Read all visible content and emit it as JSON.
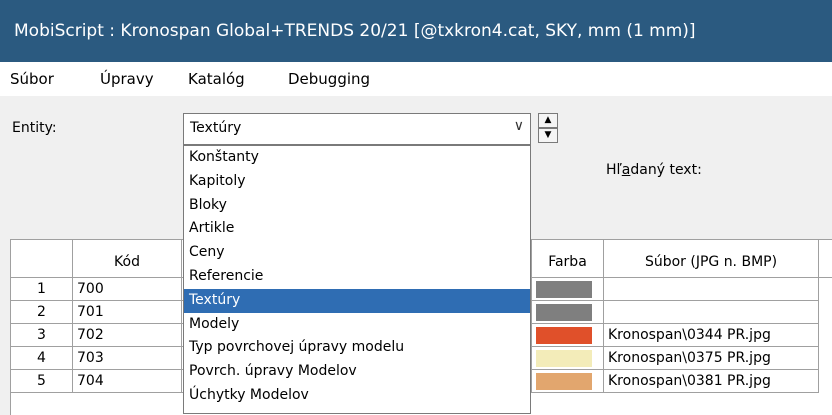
{
  "window": {
    "title": "MobiScript : Kronospan Global+TRENDS 20/21  [@txkron4.cat, SKY, mm (1 mm)]"
  },
  "menu": [
    "Súbor",
    "Úpravy",
    "Katalóg",
    "Debugging"
  ],
  "entity": {
    "label": "Entity:",
    "selected": "Textúry",
    "options": [
      "Konštanty",
      "Kapitoly",
      "Bloky",
      "Artikle",
      "Ceny",
      "Referencie",
      "Textúry",
      "Modely",
      "Typ povrchovej úpravy modelu",
      "Povrch. úpravy Modelov",
      "Úchytky Modelov"
    ]
  },
  "search": {
    "label_pre": "Hľ",
    "label_u": "a",
    "label_post": "daný text:"
  },
  "grid": {
    "headers": {
      "kod": "Kód",
      "farba": "Farba",
      "subor": "Súbor (JPG n. BMP)"
    },
    "rows": [
      {
        "num": "1",
        "kod": "700",
        "color": "#7f7f7f",
        "subor": ""
      },
      {
        "num": "2",
        "kod": "701",
        "color": "#7f7f7f",
        "subor": ""
      },
      {
        "num": "3",
        "kod": "702",
        "color": "#e0502a",
        "subor": "Kronospan\\0344 PR.jpg"
      },
      {
        "num": "4",
        "kod": "703",
        "color": "#f3ecb9",
        "subor": "Kronospan\\0375 PR.jpg"
      },
      {
        "num": "5",
        "kod": "704",
        "color": "#e2a66e",
        "subor": "Kronospan\\0381 PR.jpg"
      }
    ]
  },
  "colors": {
    "titlebar": "#2b5a80",
    "selection": "#2f6db3"
  }
}
